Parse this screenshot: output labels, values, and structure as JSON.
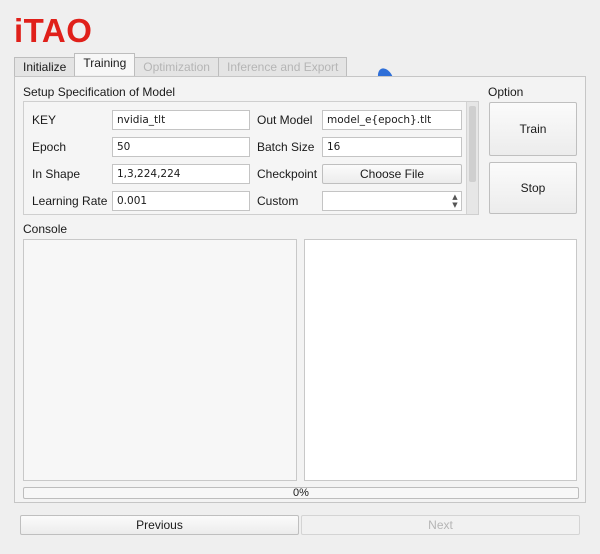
{
  "app": {
    "logo": "iTAO",
    "accent": "#e0201a"
  },
  "tabs": [
    {
      "label": "Initialize",
      "state": "normal"
    },
    {
      "label": "Training",
      "state": "active"
    },
    {
      "label": "Optimization",
      "state": "disabled"
    },
    {
      "label": "Inference and Export",
      "state": "disabled"
    }
  ],
  "setup": {
    "title": "Setup Specification of Model",
    "key": {
      "label": "KEY",
      "value": "nvidia_tlt"
    },
    "out_model": {
      "label": "Out Model",
      "value": "model_e{epoch}.tlt"
    },
    "epoch": {
      "label": "Epoch",
      "value": "50"
    },
    "batch_size": {
      "label": "Batch Size",
      "value": "16"
    },
    "in_shape": {
      "label": "In Shape",
      "value": "1,3,224,224"
    },
    "checkpoint": {
      "label": "Checkpoint",
      "button": "Choose File"
    },
    "learning_rate": {
      "label": "Learning Rate",
      "value": "0.001"
    },
    "custom": {
      "label": "Custom",
      "value": ""
    }
  },
  "option": {
    "title": "Option",
    "train": "Train",
    "stop": "Stop"
  },
  "console": {
    "title": "Console"
  },
  "progress": {
    "text": "0%",
    "value": 0
  },
  "nav": {
    "previous": "Previous",
    "next": "Next"
  }
}
